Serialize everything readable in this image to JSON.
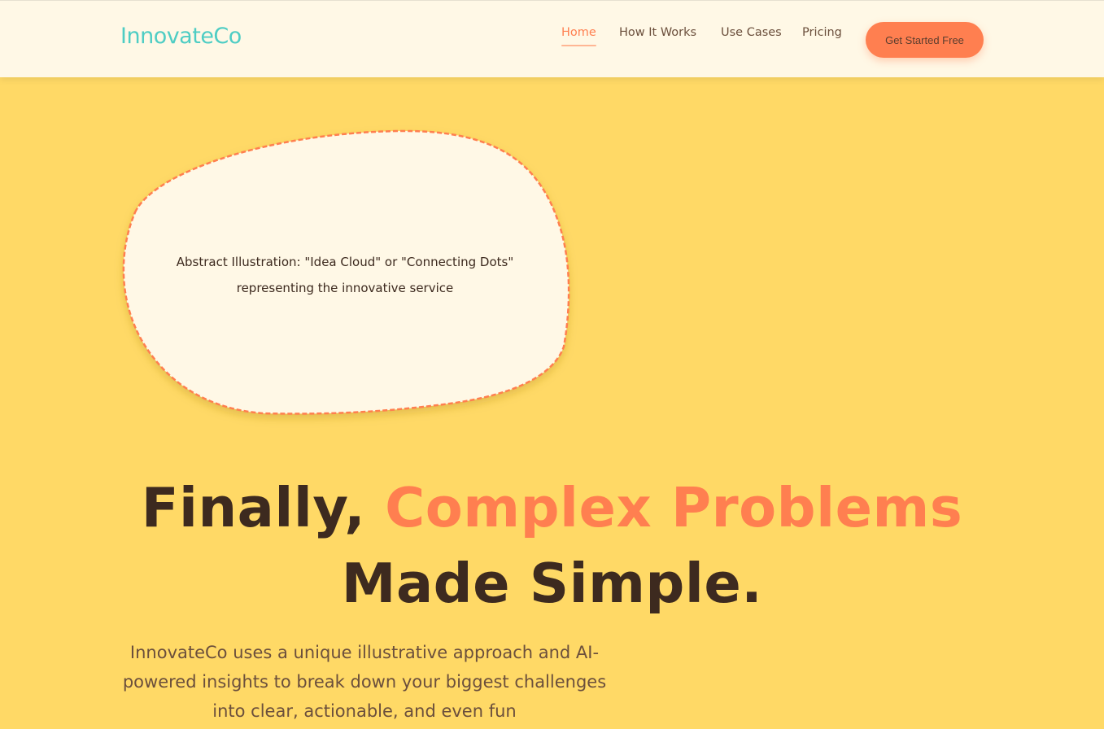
{
  "header": {
    "logo": "InnovateCo",
    "nav": [
      {
        "label": "Home",
        "active": true
      },
      {
        "label": "How It Works",
        "active": false
      },
      {
        "label": "Use Cases",
        "active": false
      },
      {
        "label": "Pricing",
        "active": false
      }
    ],
    "cta_label": "Get Started Free"
  },
  "hero": {
    "illustration_caption_line1": "Abstract Illustration: \"Idea Cloud\" or \"Connecting Dots\"",
    "illustration_caption_line2": "representing the innovative service",
    "headline_part1": "Finally, ",
    "headline_accent": "Complex Problems",
    "headline_part2": "Made Simple.",
    "description": "InnovateCo uses a unique illustrative approach and AI-powered insights to break down your biggest challenges into clear, actionable, and even fun"
  },
  "colors": {
    "background": "#FFD966",
    "header_bg": "#FFF8E6",
    "brand": "#4ECDC4",
    "accent": "#FF7F50",
    "text_dark": "#3d2a1f",
    "text_muted": "#6b4f3c"
  }
}
